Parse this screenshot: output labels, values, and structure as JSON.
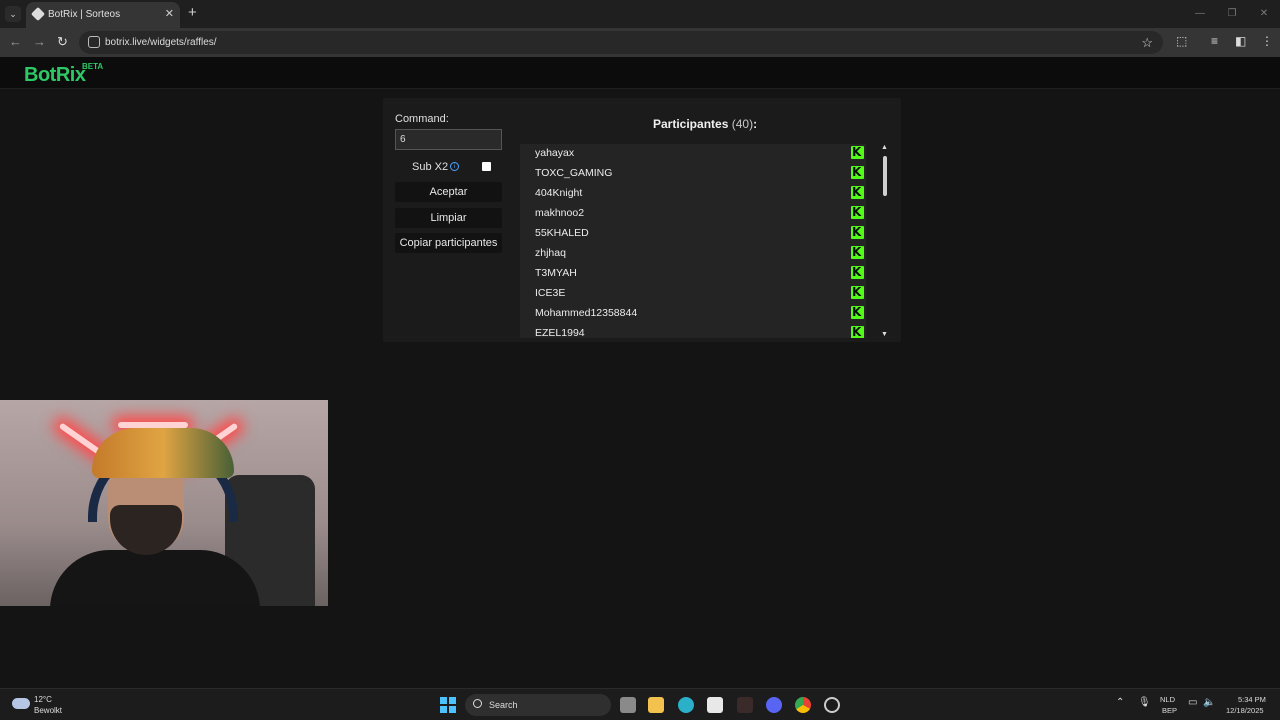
{
  "browser": {
    "tab_title": "BotRix | Sorteos",
    "url": "botrix.live/widgets/raffles/"
  },
  "site": {
    "logo": "BotRix",
    "badge": "BETA"
  },
  "raffle": {
    "command_label": "Command:",
    "command_value": "6",
    "sub_x2_label": "Sub X2",
    "sub_x2_checked": false,
    "accept_label": "Aceptar",
    "clear_label": "Limpiar",
    "copy_label": "Copiar participantes",
    "participants_title": "Participantes",
    "participants_count": "(40)",
    "participants_colon": ":",
    "participants": [
      "yahayax",
      "TOXC_GAMING",
      "404Knight",
      "makhnoo2",
      "55KHALED",
      "zhjhaq",
      "T3MYAH",
      "ICE3E",
      "Mohammed12358844",
      "EZEL1994"
    ],
    "platform_icon": "kick-icon",
    "accent_color": "#53fc18"
  },
  "taskbar": {
    "temperature": "12°C",
    "weather": "Bewolkt",
    "search_placeholder": "Search",
    "lang_top": "NLD",
    "lang_bottom": "BEP",
    "time": "5:34 PM",
    "date": "12/18/2025"
  }
}
